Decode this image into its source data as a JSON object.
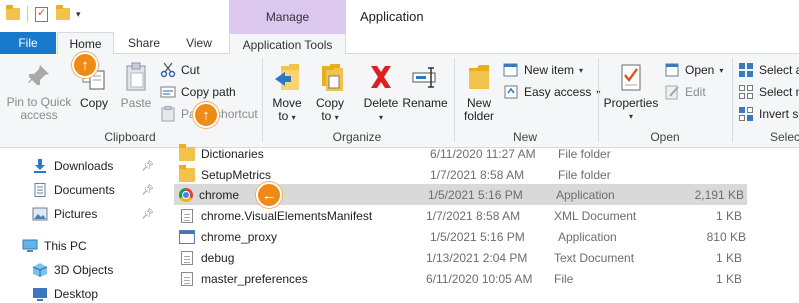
{
  "window": {
    "title": "Application",
    "context_tab_header": "Manage"
  },
  "tabs": {
    "file": "File",
    "home": "Home",
    "share": "Share",
    "view": "View",
    "application_tools": "Application Tools"
  },
  "ribbon": {
    "clipboard": {
      "label": "Clipboard",
      "pin_line1": "Pin to Quick",
      "pin_line2": "access",
      "copy": "Copy",
      "paste": "Paste",
      "cut": "Cut",
      "copy_path": "Copy path",
      "paste_shortcut": "Paste shortcut"
    },
    "organize": {
      "label": "Organize",
      "move_to_line1": "Move",
      "move_to_line2": "to",
      "copy_to_line1": "Copy",
      "copy_to_line2": "to",
      "delete": "Delete",
      "rename": "Rename"
    },
    "new": {
      "label": "New",
      "new_folder_line1": "New",
      "new_folder_line2": "folder",
      "new_item": "New item",
      "easy_access": "Easy access"
    },
    "open": {
      "label": "Open",
      "properties": "Properties",
      "open": "Open",
      "edit": "Edit"
    },
    "select": {
      "label": "Selec",
      "select_all": "Select al",
      "select_none": "Select n",
      "invert": "Invert se"
    }
  },
  "nav": {
    "items": [
      {
        "label": "Downloads",
        "pinned": true
      },
      {
        "label": "Documents",
        "pinned": true
      },
      {
        "label": "Pictures",
        "pinned": true
      },
      {
        "label": "This PC",
        "pinned": false
      },
      {
        "label": "3D Objects",
        "pinned": false
      },
      {
        "label": "Desktop",
        "pinned": false
      }
    ]
  },
  "files": {
    "rows": [
      {
        "name": "Dictionaries",
        "date": "6/11/2020 11:27 AM",
        "type": "File folder",
        "size": "",
        "icon": "folder-icon"
      },
      {
        "name": "SetupMetrics",
        "date": "1/7/2021 8:58 AM",
        "type": "File folder",
        "size": "",
        "icon": "folder-icon"
      },
      {
        "name": "chrome",
        "date": "1/5/2021 5:16 PM",
        "type": "Application",
        "size": "2,191 KB",
        "icon": "chrome-icon",
        "selected": true
      },
      {
        "name": "chrome.VisualElementsManifest",
        "date": "1/7/2021 8:58 AM",
        "type": "XML Document",
        "size": "1 KB",
        "icon": "document-icon"
      },
      {
        "name": "chrome_proxy",
        "date": "1/5/2021 5:16 PM",
        "type": "Application",
        "size": "810 KB",
        "icon": "application-icon"
      },
      {
        "name": "debug",
        "date": "1/13/2021 2:04 PM",
        "type": "Text Document",
        "size": "1 KB",
        "icon": "document-icon"
      },
      {
        "name": "master_preferences",
        "date": "6/11/2020 10:05 AM",
        "type": "File",
        "size": "1 KB",
        "icon": "document-icon"
      }
    ]
  },
  "colors": {
    "file_tab": "#1979ca",
    "context_tab": "#dcc7ef",
    "marker": "#f08a17",
    "selection": "#d9d9d9"
  }
}
